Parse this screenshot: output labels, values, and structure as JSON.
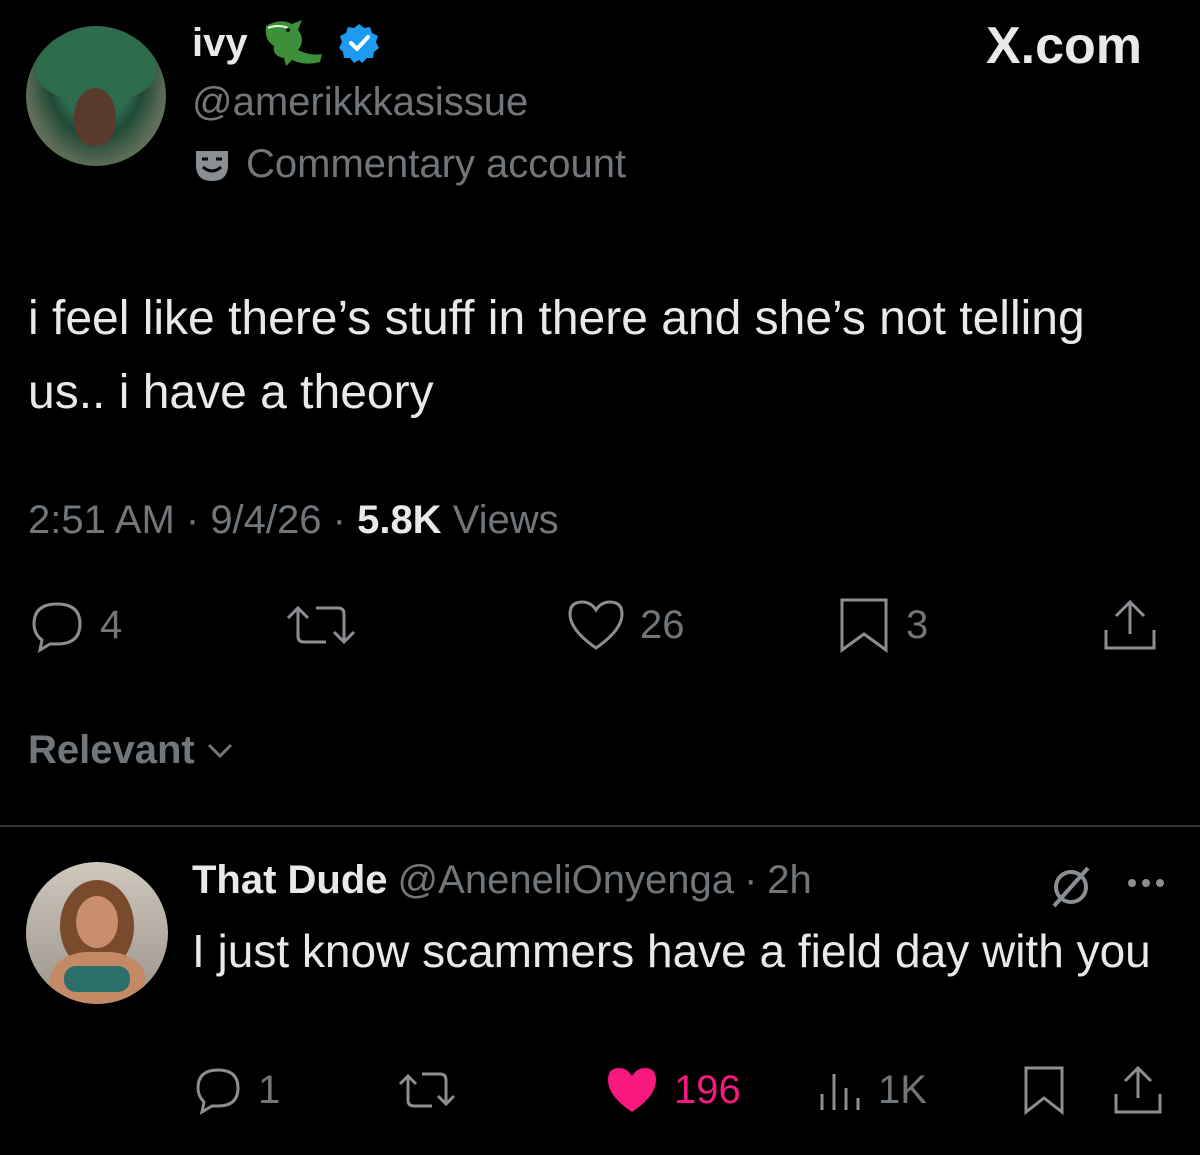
{
  "author": {
    "display_name": "ivy",
    "handle": "@amerikkkasissue",
    "label": "Commentary account",
    "verified": true,
    "badge_icon": "crocodile-emoji-icon"
  },
  "brand": {
    "watermark": "X.com"
  },
  "tweet": {
    "text": "i feel like there’s stuff in there and she’s not telling us.. i have a theory",
    "time": "2:51 AM",
    "sep1": " · ",
    "date": "9/4/26",
    "sep2": " · ",
    "views_count": "5.8K",
    "views_label": " Views"
  },
  "actions": {
    "replies": "4",
    "reposts": "",
    "likes": "26",
    "bookmarks": "3"
  },
  "sort": {
    "label": "Relevant"
  },
  "reply": {
    "display_name": "That Dude",
    "handle": "@AneneliOnyenga",
    "dot": "·",
    "time": "2h",
    "text": "I just know scammers have a field day with you",
    "replies": "1",
    "likes": "196",
    "views": "1K",
    "liked": true
  },
  "colors": {
    "background": "#000000",
    "text": "#e7e9ea",
    "muted": "#71767b",
    "verified_blue": "#1d9bf0",
    "like_pink": "#f91880"
  }
}
